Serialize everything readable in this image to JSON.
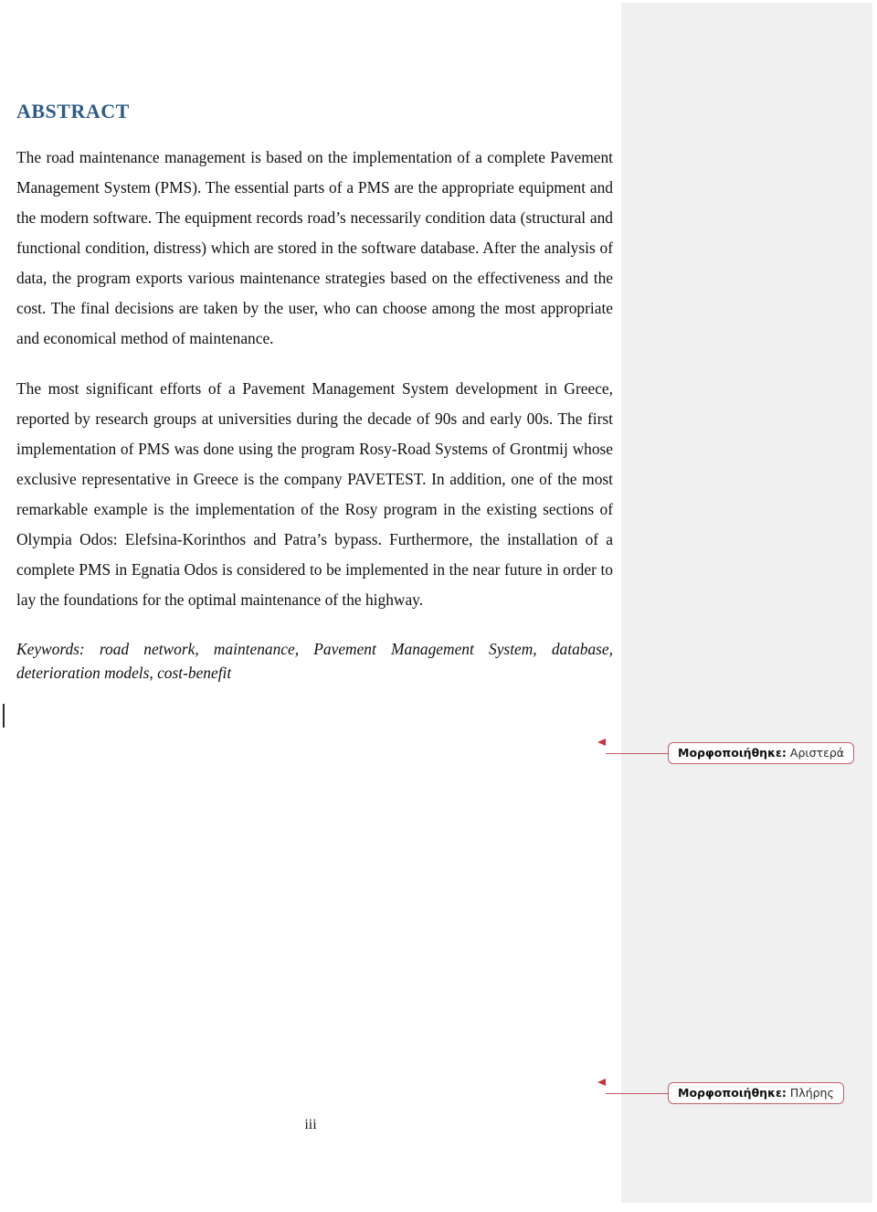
{
  "document": {
    "heading": "ABSTRACT",
    "paragraphs": [
      "The road maintenance management is based on the implementation of a complete Pavement Management System (PMS). The essential parts of a PMS are the appropriate equipment and the modern software. The equipment records road’s necessarily condition data (structural and functional condition, distress) which are stored in the software database. After the analysis of data, the program exports various maintenance strategies based on the effectiveness and the cost. The final decisions are taken by the user, who can choose among the most appropriate and economical method of maintenance.",
      "The most significant efforts of a Pavement Management System development in Greece, reported by research groups at universities during the decade of 90s and early 00s. The first implementation of PMS was done using the program Rosy-Road Systems of Grontmij whose exclusive representative in Greece is the company PAVETEST. In addition, one of the most remarkable example is the implementation of the Rosy program in the existing sections of Olympia Odos: Elefsina-Korinthos and Patra’s bypass. Furthermore, the installation of a complete PMS in Egnatia Odos is considered to be implemented in the near future in order to lay the foundations for the optimal maintenance of the highway."
    ],
    "keywords": "Keywords: road network, maintenance, Pavement Management System, database, deterioration models, cost-benefit",
    "page_number": "iii"
  },
  "comments": [
    {
      "label": "Μορφοποιήθηκε:",
      "value": "Αριστερά"
    },
    {
      "label": "Μορφοποιήθηκε:",
      "value": "Πλήρης"
    }
  ],
  "colors": {
    "heading": "#2e5c86",
    "margin_panel": "#f0f0f0",
    "callout_border": "#c2616c",
    "callout_arrow": "#c8313f",
    "change_bar": "#2b2b2b"
  }
}
